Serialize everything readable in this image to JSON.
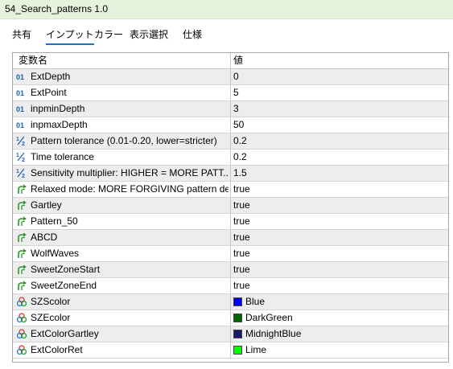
{
  "window": {
    "title": "54_Search_patterns 1.0"
  },
  "tabs": [
    {
      "label": "共有",
      "active": false
    },
    {
      "label": "インプット",
      "active": true
    },
    {
      "label": "カラー",
      "active": false
    },
    {
      "label": "表示選択",
      "active": false
    },
    {
      "label": "仕様",
      "active": false
    }
  ],
  "table": {
    "headers": {
      "name": "変数名",
      "value": "値"
    },
    "rows": [
      {
        "icon": "integer-icon",
        "name": "ExtDepth",
        "value": "0"
      },
      {
        "icon": "integer-icon",
        "name": "ExtPoint",
        "value": "5"
      },
      {
        "icon": "integer-icon",
        "name": "inpminDepth",
        "value": "3"
      },
      {
        "icon": "integer-icon",
        "name": "inpmaxDepth",
        "value": "50"
      },
      {
        "icon": "fraction-icon",
        "name": "Pattern tolerance (0.01-0.20, lower=stricter)",
        "value": "0.2"
      },
      {
        "icon": "fraction-icon",
        "name": "Time tolerance",
        "value": "0.2"
      },
      {
        "icon": "fraction-icon",
        "name": "Sensitivity multiplier: HIGHER = MORE PATT...",
        "value": "1.5"
      },
      {
        "icon": "boolean-arrow-icon",
        "name": "Relaxed mode: MORE FORGIVING pattern de...",
        "value": "true"
      },
      {
        "icon": "boolean-arrow-icon",
        "name": "Gartley",
        "value": "true"
      },
      {
        "icon": "boolean-arrow-icon",
        "name": "Pattern_50",
        "value": "true"
      },
      {
        "icon": "boolean-arrow-icon",
        "name": "ABCD",
        "value": "true"
      },
      {
        "icon": "boolean-arrow-icon",
        "name": "WolfWaves",
        "value": "true"
      },
      {
        "icon": "boolean-arrow-icon",
        "name": "SweetZoneStart",
        "value": "true"
      },
      {
        "icon": "boolean-arrow-icon",
        "name": "SweetZoneEnd",
        "value": "true"
      },
      {
        "icon": "color-palette-icon",
        "name": "SZScolor",
        "value": "Blue",
        "swatch": "#0000ff"
      },
      {
        "icon": "color-palette-icon",
        "name": "SZEcolor",
        "value": "DarkGreen",
        "swatch": "#006400"
      },
      {
        "icon": "color-palette-icon",
        "name": "ExtColorGartley",
        "value": "MidnightBlue",
        "swatch": "#191970"
      },
      {
        "icon": "color-palette-icon",
        "name": "ExtColorRet",
        "value": "Lime",
        "swatch": "#00ff00"
      }
    ]
  }
}
